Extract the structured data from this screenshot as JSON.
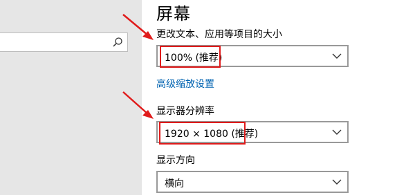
{
  "sidebar": {
    "search": {
      "placeholder": "",
      "icon": "search-icon"
    }
  },
  "display": {
    "title": "屏幕",
    "scale": {
      "label": "更改文本、应用等项目的大小",
      "value": "100% (推荐)"
    },
    "advanced_link": "高级缩放设置",
    "resolution": {
      "label": "显示器分辨率",
      "value": "1920 × 1080 (推荐)"
    },
    "orientation": {
      "label": "显示方向",
      "value": "横向"
    }
  },
  "annotations": {
    "color": "#e01b1b",
    "arrows": [
      "arrow-icon",
      "arrow-icon"
    ]
  },
  "colors": {
    "link": "#0063b1",
    "sidebar_bg": "#e6e6e6",
    "dropdown_border": "#999999"
  }
}
